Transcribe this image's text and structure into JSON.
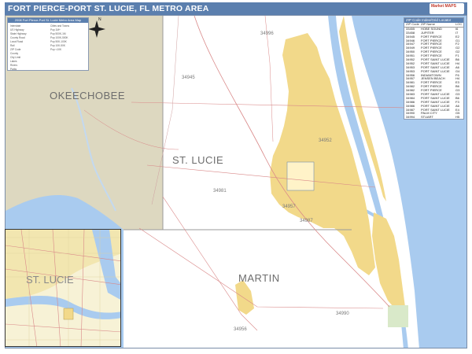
{
  "title": "FORT PIERCE-PORT ST. LUCIE, FL METRO AREA",
  "publisher_logo": "Market MAPS",
  "compass": "N",
  "county_labels": [
    "OKEECHOBEE",
    "ST. LUCIE",
    "MARTIN"
  ],
  "inset_label": "ST. LUCIE",
  "zip_labels": [
    "34945",
    "34981",
    "34956",
    "34957",
    "34990",
    "34996",
    "34952",
    "34987"
  ],
  "legend": {
    "title": "2008 Fort Pierce-Port St. Lucie Metro Area Map",
    "left_items": [
      "Interstate",
      "US Highway",
      "State Highway",
      "County Road",
      "Local Road",
      "Rail",
      "ZIP Code",
      "County",
      "City Limit",
      "Lakes",
      "Rivers",
      "Parks"
    ],
    "right_items": [
      "Cities and Towns",
      "Pop 1M+",
      "Pop 500K-1M",
      "Pop 100K-500K",
      "Pop 50K-100K",
      "Pop 10K-50K",
      "Pop <10K"
    ]
  },
  "zip_table": {
    "title": "ZIP Code Index/Grid Locator",
    "headers": [
      "ZIP Code",
      "ZIP Name",
      "LOC"
    ],
    "rows": [
      [
        "33455",
        "HOBE SOUND",
        "I6"
      ],
      [
        "33458",
        "JUPITER",
        "I7"
      ],
      [
        "34945",
        "FORT PIERCE",
        "E2"
      ],
      [
        "34946",
        "FORT PIERCE",
        "G1"
      ],
      [
        "34947",
        "FORT PIERCE",
        "F2"
      ],
      [
        "34949",
        "FORT PIERCE",
        "G2"
      ],
      [
        "34950",
        "FORT PIERCE",
        "G2"
      ],
      [
        "34951",
        "FORT PIERCE",
        "F1"
      ],
      [
        "34952",
        "PORT SAINT LUCIE",
        "B6"
      ],
      [
        "34952",
        "PORT SAINT LUCIE",
        "H4"
      ],
      [
        "34953",
        "PORT SAINT LUCIE",
        "A6"
      ],
      [
        "34953",
        "PORT SAINT LUCIE",
        "G4"
      ],
      [
        "34956",
        "INDIANTOWN",
        "F6"
      ],
      [
        "34957",
        "JENSEN BEACH",
        "H4"
      ],
      [
        "34981",
        "FORT PIERCE",
        "E3"
      ],
      [
        "34982",
        "FORT PIERCE",
        "B6"
      ],
      [
        "34982",
        "FORT PIERCE",
        "G3"
      ],
      [
        "34983",
        "PORT SAINT LUCIE",
        "G3"
      ],
      [
        "34984",
        "PORT SAINT LUCIE",
        "B6"
      ],
      [
        "34986",
        "PORT SAINT LUCIE",
        "F3"
      ],
      [
        "34986",
        "PORT SAINT LUCIE",
        "A6"
      ],
      [
        "34987",
        "PORT SAINT LUCIE",
        "E4"
      ],
      [
        "34990",
        "PALM CITY",
        "G5"
      ],
      [
        "34994",
        "STUART",
        "H5"
      ],
      [
        "34996",
        "STUART",
        "I4"
      ],
      [
        "34997",
        "STUART",
        "H6"
      ]
    ]
  },
  "colors": {
    "title_bar": "#5b7fae",
    "urban": "#f2d98a",
    "water": "#a9cbef",
    "okeechobee_land": "#ddd8c0",
    "park": "#d9e9c9",
    "roads": "#d98888",
    "county_boundary": "#9a9a9a"
  }
}
